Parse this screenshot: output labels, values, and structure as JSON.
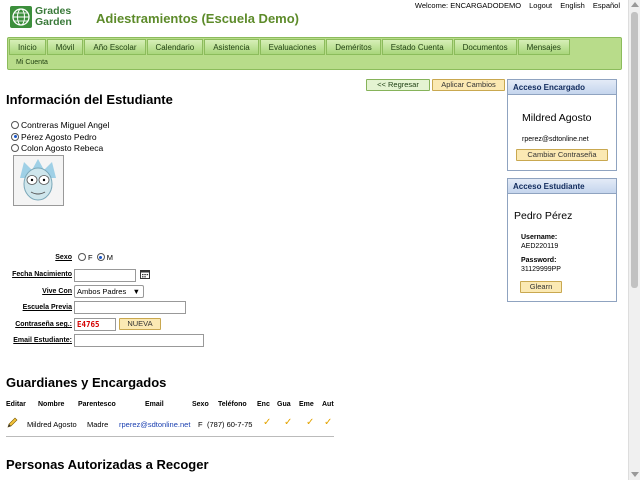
{
  "header": {
    "logo_line1": "Grades",
    "logo_line2": "Garden",
    "title": "Adiestramientos (Escuela Demo)",
    "welcome": "Welcome: ENCARGADODEMO",
    "logout": "Logout",
    "lang_en": "English",
    "lang_es": "Español"
  },
  "nav": {
    "items": [
      "Inicio",
      "Móvil",
      "Año Escolar",
      "Calendario",
      "Asistencia",
      "Evaluaciones",
      "Deméritos",
      "Estado Cuenta",
      "Documentos",
      "Mensajes"
    ],
    "sub": "Mi Cuenta"
  },
  "actions": {
    "back": "<< Regresar",
    "apply": "Aplicar Cambios"
  },
  "student_info": {
    "heading": "Información del Estudiante",
    "students": [
      "Contreras Miguel Angel",
      "Pérez Agosto Pedro",
      "Colon Agosto Rebeca"
    ],
    "selected_index": 1
  },
  "form": {
    "sexo_label": "Sexo",
    "sexo_f": "F",
    "sexo_m": "M",
    "sexo_selected": "M",
    "fecha_label": "Fecha Nacimiento",
    "fecha_value": "",
    "vive_label": "Vive Con",
    "vive_value": "Ambos Padres",
    "escuela_label": "Escuela Previa",
    "escuela_value": "",
    "pass_label": "Contraseña seg.:",
    "pass_value": "E4765",
    "pass_new": "NUEVA",
    "email_label": "Email Estudiante:",
    "email_value": ""
  },
  "acceso_encargado": {
    "title": "Acceso Encargado",
    "name": "Mildred Agosto",
    "email": "rperez@sdtonline.net",
    "change_pw": "Cambiar Contraseña"
  },
  "acceso_estudiante": {
    "title": "Acceso Estudiante",
    "name": "Pedro Pérez",
    "username_label": "Username:",
    "username": "AED220119",
    "password_label": "Password:",
    "password": "31129999PP",
    "button": "Glearn"
  },
  "guardians": {
    "heading": "Guardianes y Encargados",
    "columns": [
      "Editar",
      "Nombre",
      "Parentesco",
      "Email",
      "Sexo",
      "Teléfono",
      "Enc",
      "Gua",
      "Eme",
      "Aut"
    ],
    "rows": [
      {
        "nombre": "Mildred Agosto",
        "parentesco": "Madre",
        "email": "rperez@sdtonline.net",
        "sexo": "F",
        "telefono": "(787) 60-7-75"
      }
    ]
  },
  "recoger": {
    "heading": "Personas Autorizadas a Recoger"
  },
  "icons": {
    "edit": "pencil-icon",
    "check": "check-icon",
    "calendar": "calendar-icon"
  },
  "colors": {
    "nav_bg": "#b8dc8a",
    "title_green": "#5d8b2a",
    "panel_head": "#c5d5ed",
    "check": "#e3a300"
  }
}
